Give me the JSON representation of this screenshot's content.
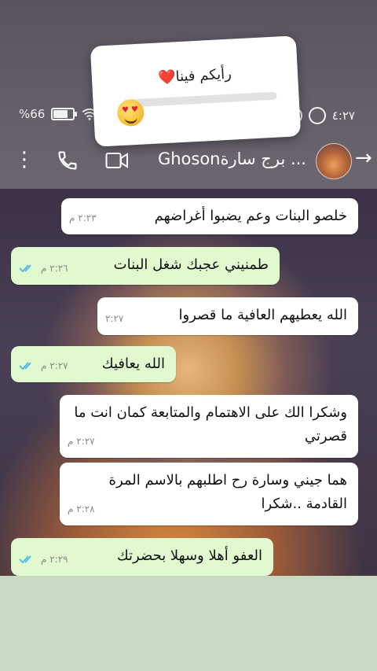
{
  "status_bar": {
    "time": "٤:٢٧",
    "battery_label": "%66",
    "battery_level": 0.66
  },
  "chat_header": {
    "title": "... برج سارةGhoson"
  },
  "story_overlay": {
    "poll_question": "رأيكم فينا❤️",
    "slider_emoji": "😍"
  },
  "messages": [
    {
      "direction": "in",
      "text": "خلصو البنات وعم يضبوا أغراضهم",
      "time": "٢:٢٣ م"
    },
    {
      "direction": "out",
      "text": "طمنيني عجبك شغل البنات",
      "time": "٢:٢٦ م"
    },
    {
      "direction": "in",
      "text": "الله يعطيهم العافية ما قصروا",
      "time": "٢:٢٧"
    },
    {
      "direction": "out",
      "text": "الله يعافيك",
      "time": "٢:٢٧ م"
    },
    {
      "direction": "in",
      "text": "وشكرا الك على الاهتمام والمتابعة كمان انت ما قصرتي",
      "time": "٢:٢٧ م"
    },
    {
      "direction": "in",
      "text": "هما جيني وسارة رح اطلبهم بالاسم المرة القادمة ..شكرا",
      "time": "٢:٢٨ م"
    },
    {
      "direction": "out",
      "text": "العفو أهلا وسهلا بحضرتك",
      "time": "٢:٢٩ م"
    }
  ],
  "colors": {
    "incoming_bubble": "#ffffff",
    "outgoing_bubble": "#e1f9cf",
    "read_ticks": "#4fb6ec"
  }
}
